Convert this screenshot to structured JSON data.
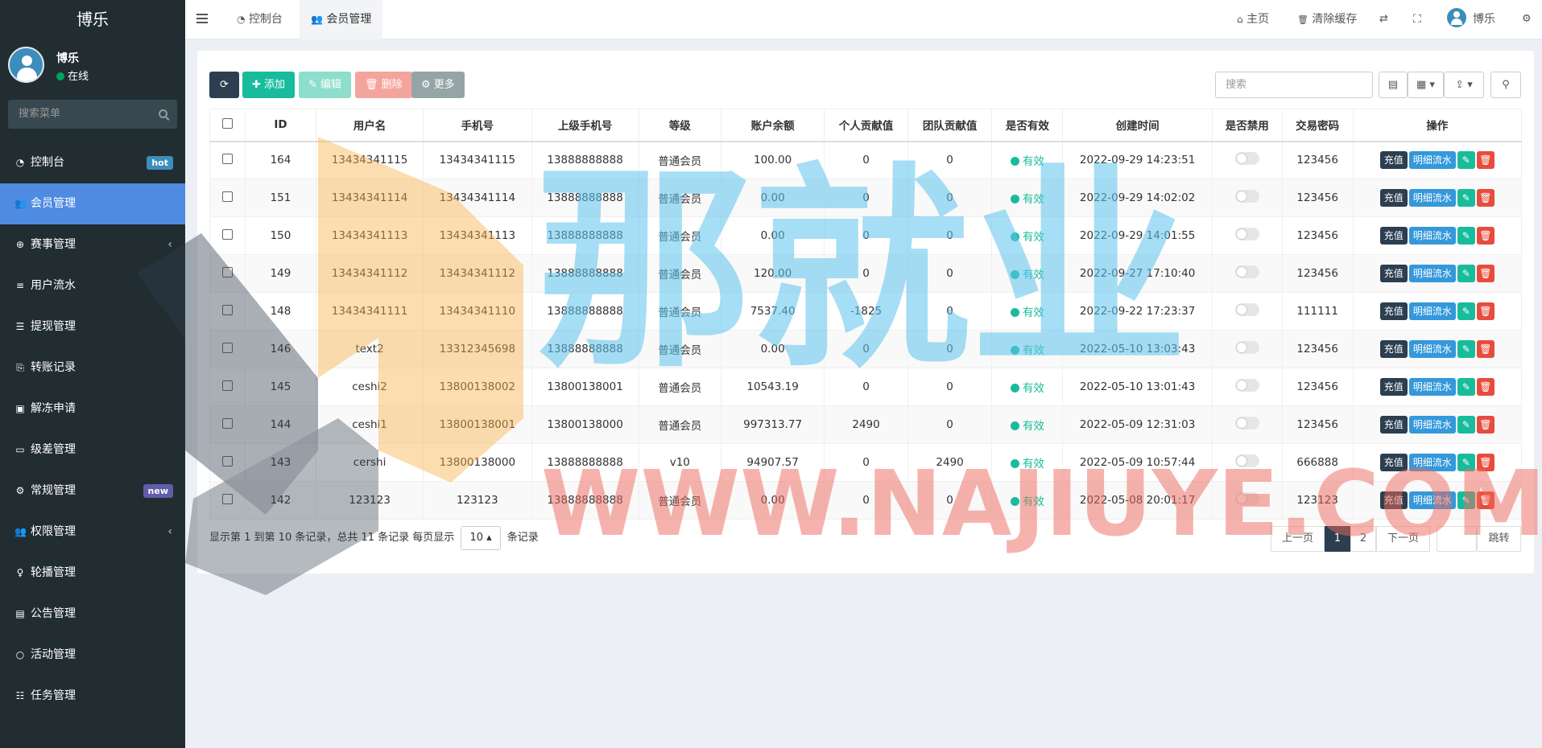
{
  "app_title": "博乐",
  "user": {
    "name": "博乐",
    "status": "在线"
  },
  "sidebar": {
    "search_placeholder": "搜索菜单",
    "items": [
      {
        "label": "控制台",
        "icon": "dashboard-icon",
        "badge": "hot",
        "badge_color": "#3c8dbc",
        "active": false,
        "chevron": false
      },
      {
        "label": "会员管理",
        "icon": "users-icon",
        "badge": "",
        "active": true,
        "chevron": false
      },
      {
        "label": "赛事管理",
        "icon": "globe-icon",
        "badge": "",
        "active": false,
        "chevron": true
      },
      {
        "label": "用户流水",
        "icon": "list-icon",
        "badge": "",
        "active": false,
        "chevron": false
      },
      {
        "label": "提现管理",
        "icon": "list-alt-icon",
        "badge": "",
        "active": false,
        "chevron": false
      },
      {
        "label": "转账记录",
        "icon": "file-transfer-icon",
        "badge": "",
        "active": false,
        "chevron": false
      },
      {
        "label": "解冻申请",
        "icon": "picture-icon",
        "badge": "",
        "active": false,
        "chevron": false
      },
      {
        "label": "级差管理",
        "icon": "window-icon",
        "badge": "",
        "active": false,
        "chevron": false
      },
      {
        "label": "常规管理",
        "icon": "cogs-icon",
        "badge": "new",
        "badge_color": "#605ca8",
        "active": false,
        "chevron": false
      },
      {
        "label": "权限管理",
        "icon": "group-icon",
        "badge": "",
        "active": false,
        "chevron": true
      },
      {
        "label": "轮播管理",
        "icon": "venus-icon",
        "badge": "",
        "active": false,
        "chevron": false
      },
      {
        "label": "公告管理",
        "icon": "notice-icon",
        "badge": "",
        "active": false,
        "chevron": false
      },
      {
        "label": "活动管理",
        "icon": "circle-icon",
        "badge": "",
        "active": false,
        "chevron": false
      },
      {
        "label": "任务管理",
        "icon": "tasks-icon",
        "badge": "",
        "active": false,
        "chevron": false
      }
    ]
  },
  "header": {
    "tabs": [
      {
        "label": "控制台",
        "active": false
      },
      {
        "label": "会员管理",
        "active": true
      }
    ],
    "home_label": "主页",
    "clear_cache_label": "清除缓存",
    "user_label": "博乐"
  },
  "toolbar": {
    "add_label": "添加",
    "edit_label": "编辑",
    "delete_label": "删除",
    "more_label": "更多",
    "search_placeholder": "搜索"
  },
  "table": {
    "columns": [
      "ID",
      "用户名",
      "手机号",
      "上级手机号",
      "等级",
      "账户余额",
      "个人贡献值",
      "团队贡献值",
      "是否有效",
      "创建时间",
      "是否禁用",
      "交易密码",
      "操作"
    ],
    "rows": [
      {
        "id": "164",
        "username": "13434341115",
        "phone": "13434341115",
        "parent_phone": "13888888888",
        "level": "普通会员",
        "balance": "100.00",
        "personal": "0",
        "team": "0",
        "valid": "有效",
        "created": "2022-09-29 14:23:51",
        "password": "123456"
      },
      {
        "id": "151",
        "username": "13434341114",
        "phone": "13434341114",
        "parent_phone": "13888888888",
        "level": "普通会员",
        "balance": "0.00",
        "personal": "0",
        "team": "0",
        "valid": "有效",
        "created": "2022-09-29 14:02:02",
        "password": "123456"
      },
      {
        "id": "150",
        "username": "13434341113",
        "phone": "13434341113",
        "parent_phone": "13888888888",
        "level": "普通会员",
        "balance": "0.00",
        "personal": "0",
        "team": "0",
        "valid": "有效",
        "created": "2022-09-29 14:01:55",
        "password": "123456"
      },
      {
        "id": "149",
        "username": "13434341112",
        "phone": "13434341112",
        "parent_phone": "13888888888",
        "level": "普通会员",
        "balance": "120.00",
        "personal": "0",
        "team": "0",
        "valid": "有效",
        "created": "2022-09-27 17:10:40",
        "password": "123456"
      },
      {
        "id": "148",
        "username": "13434341111",
        "phone": "13434341110",
        "parent_phone": "13888888888",
        "level": "普通会员",
        "balance": "7537.40",
        "personal": "-1825",
        "team": "0",
        "valid": "有效",
        "created": "2022-09-22 17:23:37",
        "password": "111111"
      },
      {
        "id": "146",
        "username": "text2",
        "phone": "13312345698",
        "parent_phone": "13888888888",
        "level": "普通会员",
        "balance": "0.00",
        "personal": "0",
        "team": "0",
        "valid": "有效",
        "created": "2022-05-10 13:03:43",
        "password": "123456"
      },
      {
        "id": "145",
        "username": "ceshi2",
        "phone": "13800138002",
        "parent_phone": "13800138001",
        "level": "普通会员",
        "balance": "10543.19",
        "personal": "0",
        "team": "0",
        "valid": "有效",
        "created": "2022-05-10 13:01:43",
        "password": "123456"
      },
      {
        "id": "144",
        "username": "ceshi1",
        "phone": "13800138001",
        "parent_phone": "13800138000",
        "level": "普通会员",
        "balance": "997313.77",
        "personal": "2490",
        "team": "0",
        "valid": "有效",
        "created": "2022-05-09 12:31:03",
        "password": "123456"
      },
      {
        "id": "143",
        "username": "cershi",
        "phone": "13800138000",
        "parent_phone": "13888888888",
        "level": "v10",
        "balance": "94907.57",
        "personal": "0",
        "team": "2490",
        "valid": "有效",
        "created": "2022-05-09 10:57:44",
        "password": "666888"
      },
      {
        "id": "142",
        "username": "123123",
        "phone": "123123",
        "parent_phone": "13888888888",
        "level": "普通会员",
        "balance": "0.00",
        "personal": "0",
        "team": "0",
        "valid": "有效",
        "created": "2022-05-08 20:01:17",
        "password": "123123"
      }
    ],
    "actions": {
      "recharge": "充值",
      "detail": "明细流水"
    }
  },
  "pagination": {
    "info_prefix": "显示第 1 到第 10 条记录，总共 11 条记录 每页显示",
    "page_size": "10",
    "info_suffix": "条记录",
    "prev": "上一页",
    "pages": [
      "1",
      "2"
    ],
    "current": "1",
    "next": "下一页",
    "jump": "跳转"
  },
  "watermark": {
    "text": "WWW.NAJIUYE.COM",
    "cn_text": "那就业"
  },
  "colors": {
    "sidebar": "#222d32",
    "active_menu": "#4f8be0",
    "primary": "#2c3e50",
    "success": "#18bc9c",
    "danger": "#e74c3c",
    "info": "#3498db"
  }
}
